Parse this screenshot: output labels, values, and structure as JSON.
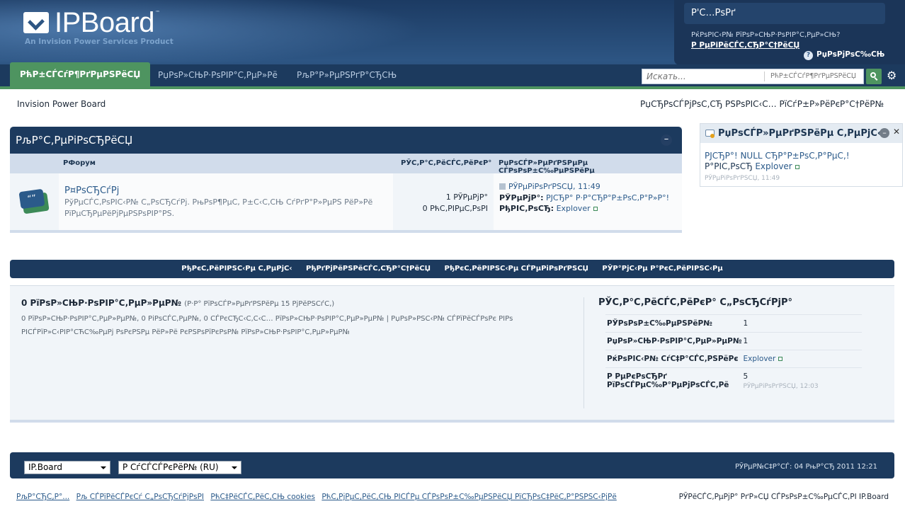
{
  "brand": {
    "name": "IPBoard",
    "tagline": "An Invision Power Services Product",
    "tm": "™"
  },
  "user_panel": {
    "username_field": "Р'С…РѕРґ",
    "question": "РќРѕРІС‹Р№ РїРѕР»СЊР·РѕРІР°С‚РµР»СЊ?",
    "register_link": "Р РµРіРёСЃС‚СЂР°С†РёСЏ",
    "help_label": "РџРѕРјРѕС‰СЊ"
  },
  "nav": {
    "tabs": [
      "РћР±СЃСѓР¶РґРµРЅРёСЏ",
      "РџРѕР»СЊР·РѕРІР°С‚РµР»Рё",
      "РљР°Р»РµРЅРґР°СЂСЊ"
    ],
    "search_placeholder": "Искать...",
    "search_scope": "РћР±СЃСѓР¶РґРµРЅРёСЏ"
  },
  "breadcrumb": {
    "home": "Invision Power Board",
    "new_posts": "РџСЂРѕСЃРјРѕС‚СЂ РЅРѕРІС‹С… РїСѓР±Р»РёРєР°С†РёР№"
  },
  "category": {
    "title": "РљР°С‚РµРіРѕСЂРёСЏ",
    "col_forum": "РФорум",
    "col_stats": "РЎС‚Р°С‚РёСЃС‚РёРєР°",
    "col_last": "РџРѕСЃР»РµРґРЅРµРµ СЃРѕРѕР±С‰РµРЅРёРµ",
    "forum": {
      "name": "Р¤РѕСЂСѓРј",
      "description": "РўРµСЃС‚РѕРІС‹Р№ С„РѕСЂСѓРј. РњРѕР¶РµС‚ Р±С‹С‚СЊ СѓРґР°Р»РµРЅ РёР»Рё РїРµСЂРµРёРјРµРЅРѕРІР°РЅ.",
      "topics": "1 РЎРµРјР°",
      "replies": "0 РћС‚РІРµС‚РѕРІ",
      "last_date": "РЎРµРіРѕРґРЅСЏ, 11:49",
      "last_topic_label": "РЎРµРјР°:",
      "last_topic": "РЈСЂР° Р·Р°СЂР°Р±РѕС‚Р°Р»Р°!",
      "last_author_label": "РђРІС‚РѕСЂ:",
      "last_author": "Explover"
    }
  },
  "sidebar": {
    "title": "РџРѕСЃР»РµРґРЅРёРµ С‚РµРјС‹",
    "post_text": "РЈСЂР°! NULL СЂР°Р±РѕС‚Р°РµС‚!",
    "post_by": "Р°РІС‚РѕСЂ",
    "author": "Explover",
    "time": "РЎРµРіРѕРґРЅСЏ, 11:49"
  },
  "links_bar": [
    "РђРєС‚РёРІРЅС‹Рµ С‚РµРјС‹",
    "РђРґРјРёРЅРёСЃС‚СЂР°С†РёСЏ",
    "РђРєС‚РёРІРЅС‹Рµ СЃРµРіРѕРґРЅСЏ",
    "РЎР°РјС‹Рµ Р°РєС‚РёРІРЅС‹Рµ"
  ],
  "online": {
    "title": "0 РїРѕР»СЊР·РѕРІР°С‚РµР»РµР№",
    "period": "(Р·Р° РїРѕСЃР»РµРґРЅРёРµ 15 РјРёРЅСѓС‚)",
    "details": "0 РїРѕР»СЊР·РѕРІР°С‚РµР»РµР№, 0 РіРѕСЃС‚РµР№, 0 СЃРєСЂС‹С‚С‹С… РїРѕР»СЊР·РѕРІР°С‚РµР»РµР№ | РџРѕР»РЅС‹Р№ СЃРїРёСЃРѕРє РІРѕ",
    "details2": "РІСЃРїР»С‹РІР°СЋС‰РµРј РѕРєРЅРµ РёР»Рё РєРЅРѕРїРєРѕР№ РїРѕР»СЊР·РѕРІР°С‚РµР»РµР№"
  },
  "forum_stats": {
    "title": "РЎС‚Р°С‚РёСЃС‚РёРєР° С„РѕСЂСѓРјР°",
    "rows": [
      {
        "label": "РЎРѕРѕР±С‰РµРЅРёР№",
        "value": "1",
        "sub": ""
      },
      {
        "label": "РџРѕР»СЊР·РѕРІР°С‚РµР»РµР№",
        "value": "1",
        "sub": ""
      },
      {
        "label": "РќРѕРІС‹Р№ СѓС‡Р°СЃС‚РЅРёРє",
        "value": "Explover",
        "sub": ""
      },
      {
        "label": "Р РµРєРѕСЂРґ РїРѕСЃРµС‰Р°РµРјРѕСЃС‚Рё",
        "value": "5",
        "sub": "РЎРµРіРѕРґРЅСЏ, 12:03"
      }
    ]
  },
  "footer": {
    "skin": "IP.Board",
    "language": "Р СѓСЃСЃРєРёР№ (RU)",
    "time": "РЎРµР№С‡Р°СЃ: 04 РњР°СЂ 2011 12:21",
    "links": [
      "РљР°СЂС‚Р°...",
      "Рљ СЃРїРёСЃРєСѓ С„РѕСЂСѓРјРѕРІ",
      "РћС‡РёСЃС‚РёС‚СЊ cookies",
      "РћС‚РјРµС‚РёС‚СЊ РІСЃРµ СЃРѕРѕР±С‰РµРЅРёСЏ РїСЂРѕС‡РёС‚Р°РЅРЅС‹РјРё"
    ],
    "powered": "РЎРёСЃС‚РµРјР° РґР»СЏ СЃРѕРѕР±С‰РµСЃС‚РІ IP.Board"
  }
}
